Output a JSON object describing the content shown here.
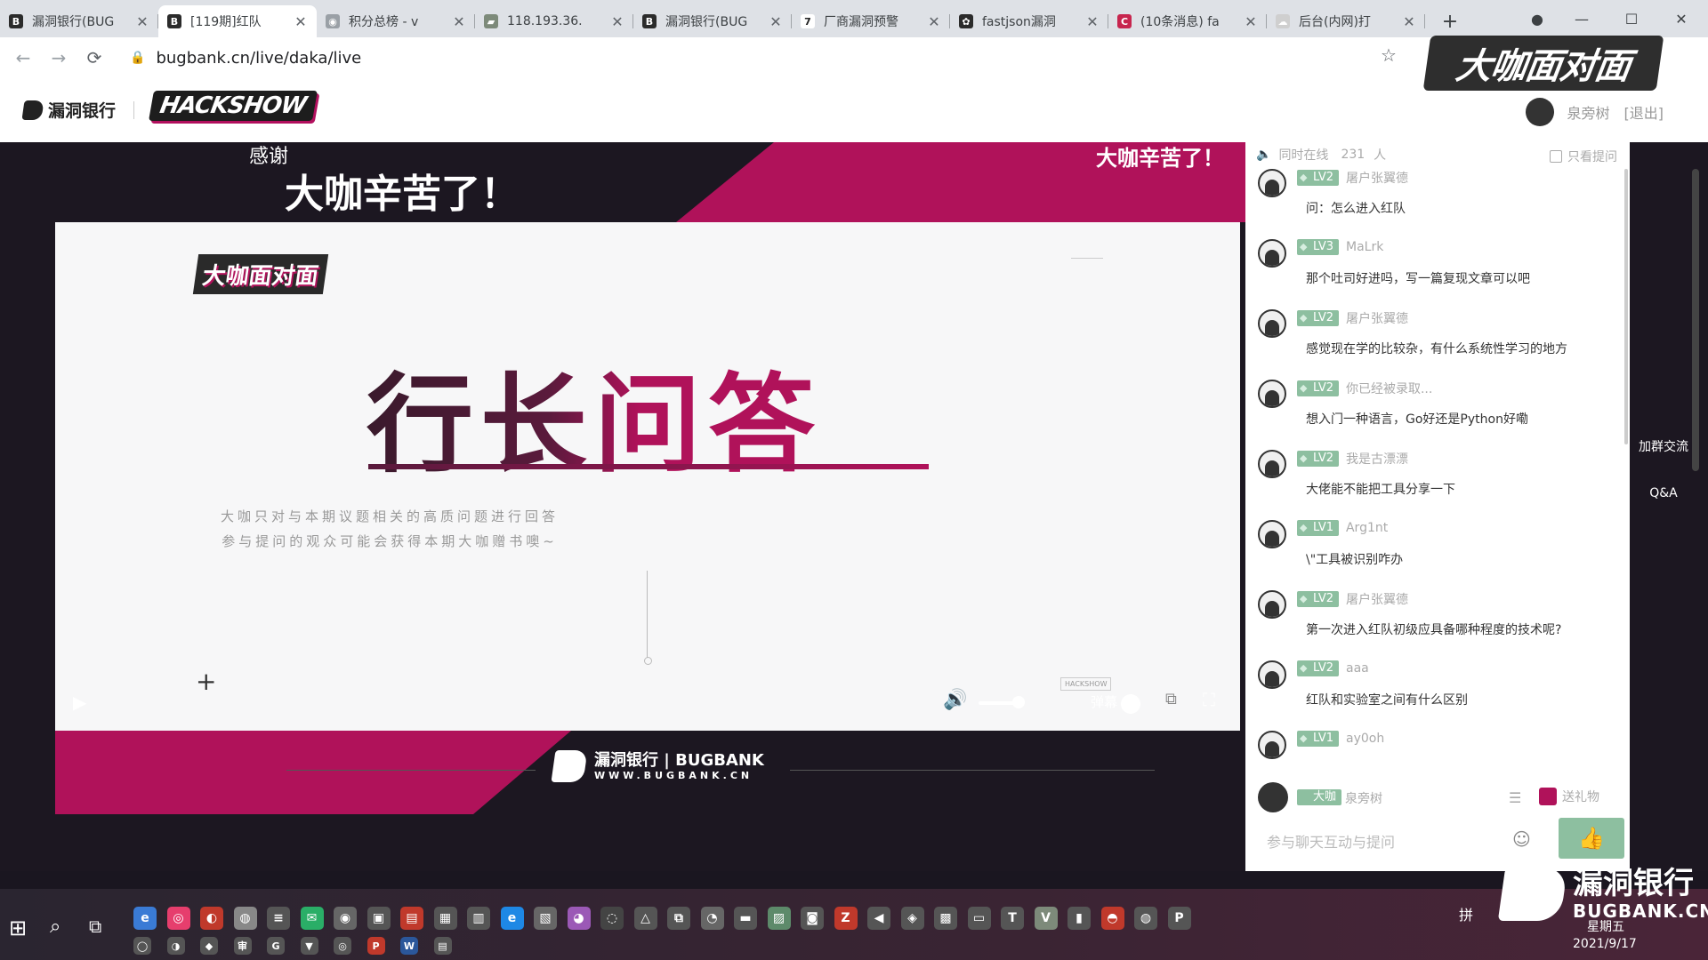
{
  "browser": {
    "tabs": [
      {
        "title": "漏洞银行(BUG",
        "color": "#2b2b2b",
        "glyph": "B"
      },
      {
        "title": "[119期]红队",
        "color": "#2b2b2b",
        "glyph": "B"
      },
      {
        "title": "积分总榜 - v",
        "color": "#9aa0a6",
        "glyph": "◉"
      },
      {
        "title": "118.193.36.",
        "color": "#7d8a7a",
        "glyph": "▰"
      },
      {
        "title": "漏洞银行(BUG",
        "color": "#2b2b2b",
        "glyph": "B"
      },
      {
        "title": "厂商漏洞预警",
        "color": "#ffffff",
        "glyph": "7"
      },
      {
        "title": "fastjson漏洞",
        "color": "#2b2b2b",
        "glyph": "✿"
      },
      {
        "title": "(10条消息) fa",
        "color": "#c7254e",
        "glyph": "C"
      },
      {
        "title": "后台(内网)打",
        "color": "#cfcfcf",
        "glyph": "☁"
      }
    ],
    "new_tab": "+",
    "window_controls": {
      "profile": "●",
      "minimize": "—",
      "maximize": "☐",
      "close": "✕"
    },
    "url": "bugbank.cn/live/daka/live",
    "back": "←",
    "forward": "→",
    "reload": "⟳",
    "lock": "🔒",
    "bookmark": "☆"
  },
  "site": {
    "brand": "漏洞银行",
    "hackshow": "HACKSHOW",
    "user_name": "泉旁树",
    "logout": "[退出]",
    "watermark": "大咖面对面"
  },
  "video": {
    "banner_small": "感谢",
    "banner_big": "大咖辛苦了！",
    "banner_right": "大咖辛苦了！",
    "slide_badge": "大咖面对面",
    "slide_title": "行长问答",
    "slide_sub1": "大咖只对与本期议题相关的高质问题进行回答",
    "slide_sub2": "参与提问的观众可能会获得本期大咖赠书噢~",
    "slide_plus": "+",
    "slide_small_logo": "HACKSHOW",
    "footer_brand": "漏洞银行 | BUGBANK",
    "footer_url": "WWW.BUGBANK.CN",
    "controls": {
      "play": "▶",
      "volume": "🔊",
      "danmu": "弹幕",
      "pip": "⧉",
      "fullscreen": "⛶"
    }
  },
  "chat": {
    "online_label": "同时在线",
    "online_count": "231",
    "online_unit": "人",
    "filter_label": "只看提问",
    "messages": [
      {
        "level": "LV2",
        "user": "屠户张翼德",
        "text": "问：怎么进入红队"
      },
      {
        "level": "LV3",
        "user": "MaLrk",
        "text": "那个吐司好进吗，写一篇复现文章可以吧"
      },
      {
        "level": "LV2",
        "user": "屠户张翼德",
        "text": "感觉现在学的比较杂，有什么系统性学习的地方"
      },
      {
        "level": "LV2",
        "user": "你已经被录取...",
        "text": "想入门一种语言，Go好还是Python好嘞"
      },
      {
        "level": "LV2",
        "user": "我是古漂漂",
        "text": "大佬能不能把工具分享一下"
      },
      {
        "level": "LV1",
        "user": "Arg1nt",
        "text": "\\\"工具被识别咋办"
      },
      {
        "level": "LV2",
        "user": "屠户张翼德",
        "text": "第一次进入红队初级应具备哪种程度的技术呢?"
      },
      {
        "level": "LV2",
        "user": "aaa",
        "text": "红队和实验室之间有什么区别"
      },
      {
        "level": "LV1",
        "user": "ay0oh",
        "text": ""
      }
    ],
    "self_role": "大咖",
    "self_name": "泉旁树",
    "list_icon": "☰",
    "gift_label": "送礼物",
    "input_placeholder": "参与聊天互动与提问",
    "emoji": "☺",
    "like": "👍"
  },
  "side_rail": {
    "group_label": "加群交流",
    "qa_label": "Q&A"
  },
  "taskbar": {
    "start": "⊞",
    "search": "⌕",
    "task_view": "⧉",
    "icons": [
      {
        "glyph": "e",
        "color": "#3a7bd5"
      },
      {
        "glyph": "◎",
        "color": "#e63e6d"
      },
      {
        "glyph": "◐",
        "color": "#c0392b"
      },
      {
        "glyph": "◍",
        "color": "#888"
      },
      {
        "glyph": "≡",
        "color": "#555"
      },
      {
        "glyph": "✉",
        "color": "#2aae67"
      },
      {
        "glyph": "◉",
        "color": "#666"
      },
      {
        "glyph": "▣",
        "color": "#555"
      },
      {
        "glyph": "▤",
        "color": "#c0392b"
      },
      {
        "glyph": "▦",
        "color": "#555"
      },
      {
        "glyph": "▥",
        "color": "#555"
      },
      {
        "glyph": "e",
        "color": "#1e88e5"
      },
      {
        "glyph": "▧",
        "color": "#666"
      },
      {
        "glyph": "◕",
        "color": "#9b59b6"
      },
      {
        "glyph": "◌",
        "color": "#444"
      },
      {
        "glyph": "△",
        "color": "#555"
      },
      {
        "glyph": "⧉",
        "color": "#555"
      },
      {
        "glyph": "◔",
        "color": "#666"
      },
      {
        "glyph": "▬",
        "color": "#555"
      },
      {
        "glyph": "▨",
        "color": "#5d8a6a"
      },
      {
        "glyph": "◙",
        "color": "#555"
      },
      {
        "glyph": "Z",
        "color": "#c0392b"
      },
      {
        "glyph": "◀",
        "color": "#555"
      },
      {
        "glyph": "◈",
        "color": "#555"
      },
      {
        "glyph": "▩",
        "color": "#555"
      },
      {
        "glyph": "▭",
        "color": "#555"
      },
      {
        "glyph": "T",
        "color": "#555"
      },
      {
        "glyph": "V",
        "color": "#7d8a7a"
      },
      {
        "glyph": "▮",
        "color": "#555"
      },
      {
        "glyph": "◓",
        "color": "#c0392b"
      },
      {
        "glyph": "◍",
        "color": "#555"
      },
      {
        "glyph": "P",
        "color": "#555"
      }
    ],
    "icons_row2": [
      {
        "glyph": "◯",
        "color": "#555"
      },
      {
        "glyph": "◑",
        "color": "#555"
      },
      {
        "glyph": "◆",
        "color": "#555"
      },
      {
        "glyph": "审",
        "color": "#555"
      },
      {
        "glyph": "G",
        "color": "#555"
      },
      {
        "glyph": "▼",
        "color": "#555"
      },
      {
        "glyph": "◎",
        "color": "#555"
      },
      {
        "glyph": "P",
        "color": "#c0392b"
      },
      {
        "glyph": "W",
        "color": "#2b579a"
      },
      {
        "glyph": "▤",
        "color": "#555"
      }
    ],
    "ime": "拼",
    "weekday": "星期五",
    "date": "2021/9/17",
    "watermark_cn": "漏洞银行",
    "watermark_en": "BUGBANK.CN"
  }
}
